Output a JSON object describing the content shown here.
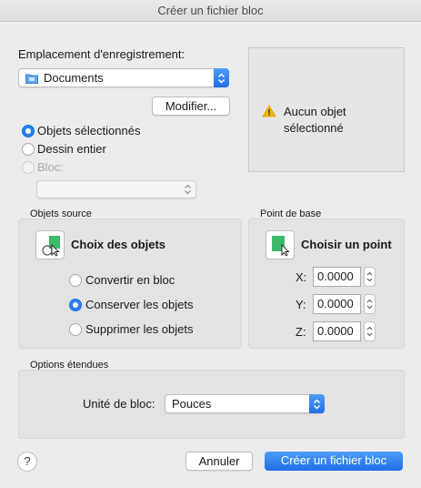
{
  "window": {
    "title": "Créer un fichier bloc"
  },
  "location": {
    "label": "Emplacement d'enregistrement:",
    "folder_value": "Documents",
    "modify_label": "Modifier..."
  },
  "preview": {
    "message_line1": "Aucun objet",
    "message_line2": "sélectionné"
  },
  "source": {
    "options": [
      {
        "label": "Objets sélectionnés",
        "selected": true,
        "enabled": true
      },
      {
        "label": "Dessin entier",
        "selected": false,
        "enabled": true
      },
      {
        "label": "Bloc:",
        "selected": false,
        "enabled": false
      }
    ],
    "block_select_value": ""
  },
  "objects_group": {
    "title": "Objets source",
    "pick_label": "Choix des objets",
    "options": [
      {
        "label": "Convertir en bloc",
        "selected": false
      },
      {
        "label": "Conserver les objets",
        "selected": true
      },
      {
        "label": "Supprimer les objets",
        "selected": false
      }
    ]
  },
  "base_point": {
    "title": "Point de base",
    "pick_label": "Choisir un point",
    "x_label": "X:",
    "x_value": "0.0000",
    "y_label": "Y:",
    "y_value": "0.0000",
    "z_label": "Z:",
    "z_value": "0.0000"
  },
  "extended": {
    "title": "Options étendues",
    "unit_label": "Unité de bloc:",
    "unit_value": "Pouces"
  },
  "footer": {
    "help_label": "?",
    "cancel_label": "Annuler",
    "create_label": "Créer un fichier bloc"
  },
  "colors": {
    "accent": "#2a7ef0",
    "warning": "#f5b800",
    "pick_green": "#3dbb6b"
  }
}
